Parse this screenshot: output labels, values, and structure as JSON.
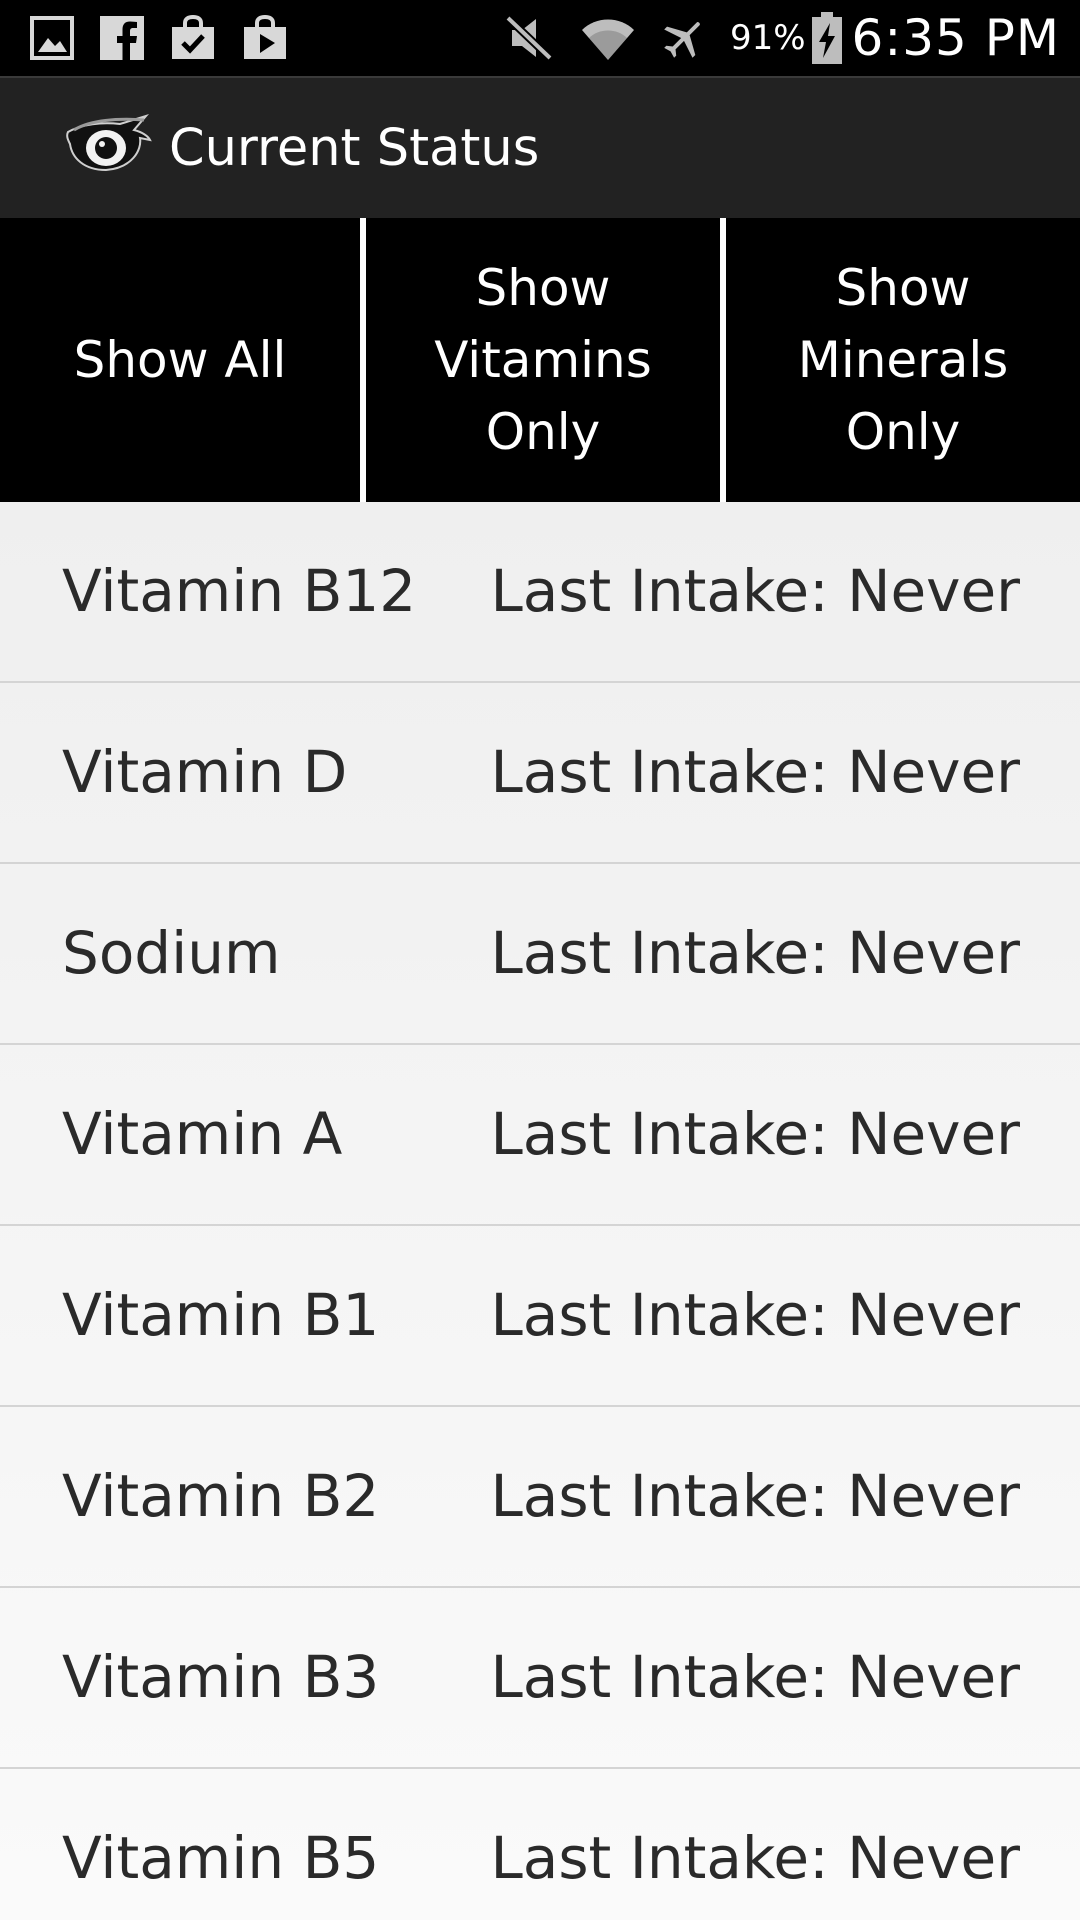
{
  "status_bar": {
    "left_icons": [
      "gallery-icon",
      "facebook-icon",
      "shopping-bag-check-icon",
      "shopping-bag-play-icon"
    ],
    "right_icons": [
      "mute-icon",
      "wifi-icon",
      "airplane-mode-icon"
    ],
    "battery_percent": "91%",
    "time": "6:35 PM"
  },
  "action_bar": {
    "logo_icon": "owl-eye-logo-icon",
    "title": "Current Status"
  },
  "filters": {
    "show_all": {
      "lines": [
        "Show All"
      ]
    },
    "show_vitamins": {
      "lines": [
        "Show",
        "Vitamins",
        "Only"
      ]
    },
    "show_minerals": {
      "lines": [
        "Show",
        "Minerals",
        "Only"
      ]
    }
  },
  "nutrients": [
    {
      "name": "Vitamin B12",
      "status": "Last Intake: Never"
    },
    {
      "name": "Vitamin D",
      "status": "Last Intake: Never"
    },
    {
      "name": "Sodium",
      "status": "Last Intake: Never"
    },
    {
      "name": "Vitamin A",
      "status": "Last Intake: Never"
    },
    {
      "name": "Vitamin B1",
      "status": "Last Intake: Never"
    },
    {
      "name": "Vitamin B2",
      "status": "Last Intake: Never"
    },
    {
      "name": "Vitamin B3",
      "status": "Last Intake: Never"
    },
    {
      "name": "Vitamin B5",
      "status": "Last Intake: Never"
    }
  ],
  "colors": {
    "status_bar_bg": "#000000",
    "action_bar_bg": "#222222",
    "filter_bg": "#000000",
    "list_bg": "#f2f2f2",
    "row_text": "#2a2a2a",
    "row_divider": "#d4d4d4"
  }
}
